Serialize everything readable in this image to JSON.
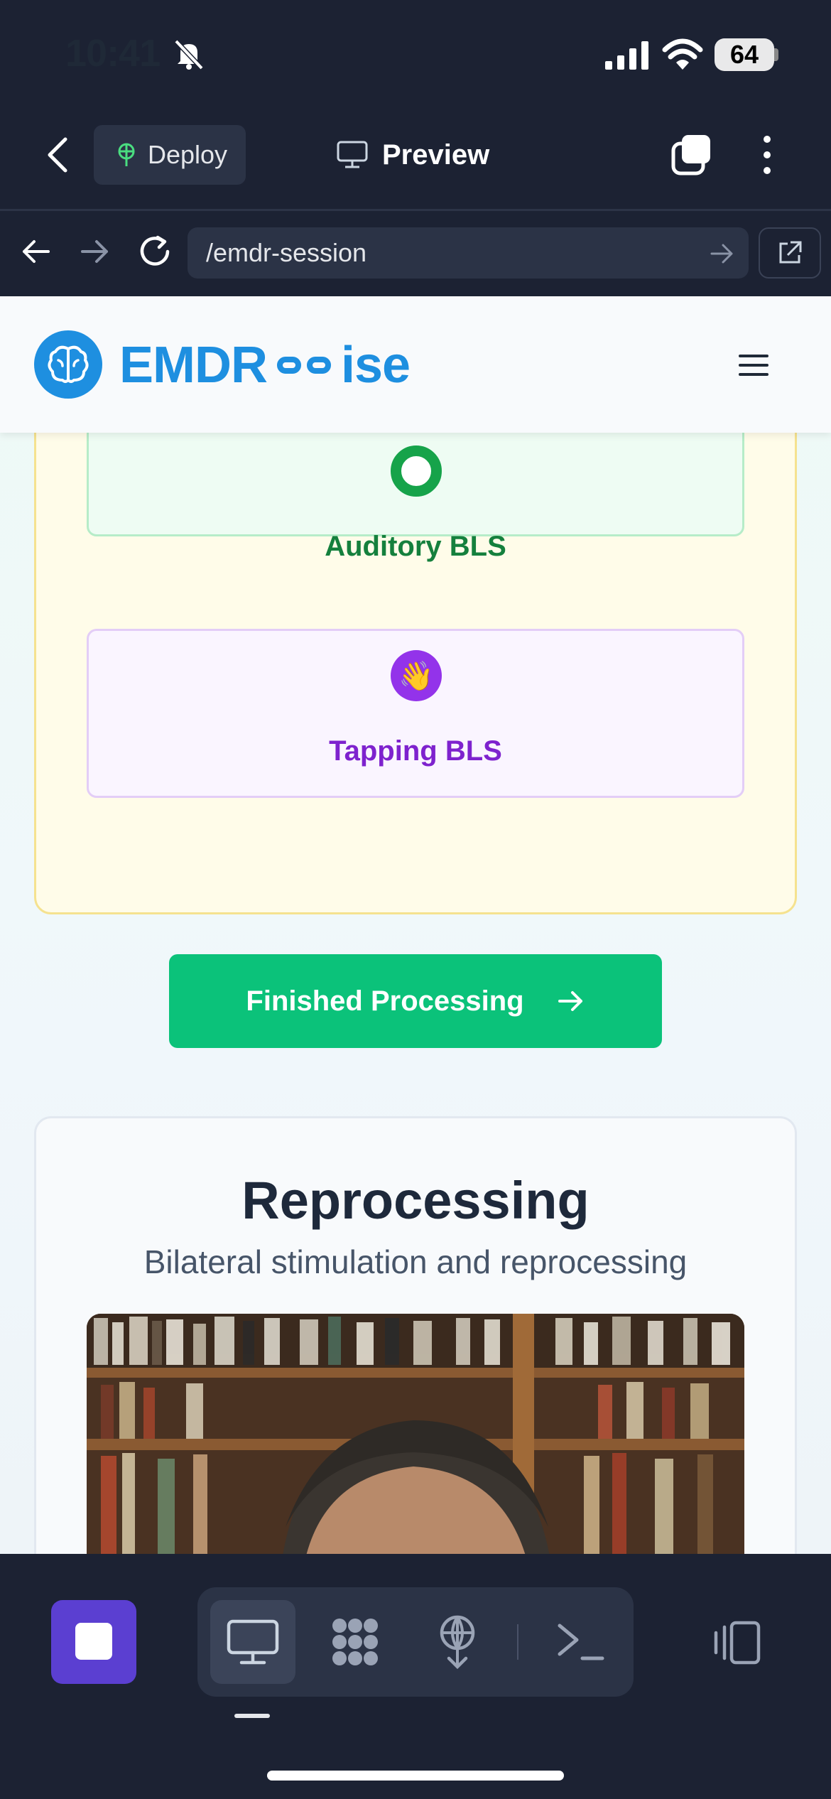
{
  "status_bar": {
    "time": "10:41",
    "battery": "64"
  },
  "toolbar": {
    "deploy_label": "Deploy",
    "preview_label": "Preview"
  },
  "address": {
    "url": "/emdr-session"
  },
  "site": {
    "logo_part1": "EMDR",
    "logo_part2": "ise"
  },
  "bls": {
    "auditory_label": "Auditory BLS",
    "tapping_label": "Tapping BLS",
    "tapping_emoji": "👋"
  },
  "actions": {
    "finish_label": "Finished Processing"
  },
  "reprocessing": {
    "title": "Reprocessing",
    "subtitle": "Bilateral stimulation and reprocessing"
  },
  "colors": {
    "accent_blue": "#1e8fe0",
    "green": "#0bc27a",
    "purple": "#9333ea",
    "dark_bg": "#1c2233"
  },
  "icons": [
    "bell-slash-icon",
    "signal-icon",
    "wifi-icon",
    "chevron-left-icon",
    "deploy-icon",
    "monitor-icon",
    "tabs-icon",
    "more-vertical-icon",
    "arrow-left-icon",
    "arrow-right-icon",
    "reload-icon",
    "external-link-icon",
    "brain-icon",
    "hamburger-icon",
    "stop-icon",
    "apps-icon",
    "terminal-icon",
    "device-icon"
  ]
}
